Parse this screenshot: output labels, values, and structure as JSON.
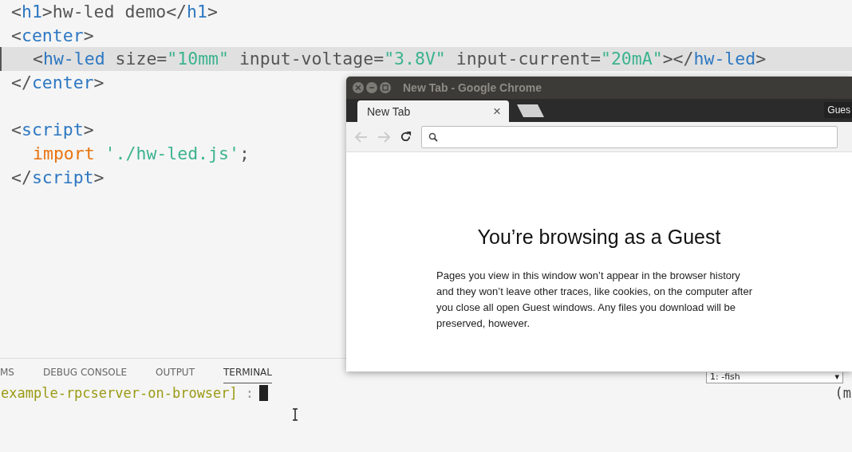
{
  "editor": {
    "lines": [
      {
        "current": false,
        "tokens": [
          {
            "kind": "punct",
            "text": "<"
          },
          {
            "kind": "tag",
            "text": "h1"
          },
          {
            "kind": "punct",
            "text": ">hw-led demo</"
          },
          {
            "kind": "tag",
            "text": "h1"
          },
          {
            "kind": "punct",
            "text": ">"
          }
        ]
      },
      {
        "current": false,
        "tokens": [
          {
            "kind": "punct",
            "text": "<"
          },
          {
            "kind": "tag",
            "text": "center"
          },
          {
            "kind": "punct",
            "text": ">"
          }
        ],
        "children": [
          {
            "current": true,
            "tokens": [
              {
                "kind": "punct",
                "text": "<"
              },
              {
                "kind": "tag",
                "text": "hw-led"
              },
              {
                "kind": "attr",
                "text": " size="
              },
              {
                "kind": "string",
                "text": "\"10mm\""
              },
              {
                "kind": "attr",
                "text": " input-voltage="
              },
              {
                "kind": "string",
                "text": "\"3.8V\""
              },
              {
                "kind": "attr",
                "text": " input-current="
              },
              {
                "kind": "string",
                "text": "\"20mA\""
              },
              {
                "kind": "punct",
                "text": "></"
              },
              {
                "kind": "tag",
                "text": "hw-led"
              },
              {
                "kind": "punct",
                "text": ">"
              }
            ]
          }
        ]
      },
      {
        "current": false,
        "tokens": [
          {
            "kind": "punct",
            "text": "</"
          },
          {
            "kind": "tag",
            "text": "center"
          },
          {
            "kind": "punct",
            "text": ">"
          }
        ]
      },
      {
        "current": false
      },
      {
        "current": false,
        "tokens": [
          {
            "kind": "punct",
            "text": "<"
          },
          {
            "kind": "tag",
            "text": "script"
          },
          {
            "kind": "punct",
            "text": ">"
          }
        ],
        "children": [
          {
            "current": false,
            "tokens": [
              {
                "kind": "keyword",
                "text": "import"
              },
              {
                "kind": "string",
                "text": " './hw-led.js'"
              },
              {
                "kind": "punct",
                "text": ";"
              }
            ]
          }
        ]
      },
      {
        "current": false,
        "tokens": [
          {
            "kind": "punct",
            "text": "</"
          },
          {
            "kind": "tag",
            "text": "script"
          },
          {
            "kind": "punct",
            "text": ">"
          }
        ]
      }
    ]
  },
  "panel": {
    "tabs": [
      {
        "label": "MS",
        "selected": false
      },
      {
        "label": "DEBUG CONSOLE",
        "selected": false
      },
      {
        "label": "OUTPUT",
        "selected": false
      },
      {
        "label": "TERMINAL",
        "selected": true
      }
    ],
    "terminal_select": "1: -fish",
    "select_arrow": "▾",
    "prompt_path": "example-rpcserver-on-browser]",
    "prompt_sep": ":",
    "right_text": "(m"
  },
  "browser": {
    "title": "New Tab - Google Chrome",
    "tab": {
      "label": "New Tab",
      "close": "×"
    },
    "profile": "Gues",
    "heading": "You’re browsing as a Guest",
    "body": "Pages you view in this window won’t appear in the browser history and they won’t leave other traces, like cookies, on the computer after you close all open Guest windows. Any files you download will be preserved, however."
  }
}
